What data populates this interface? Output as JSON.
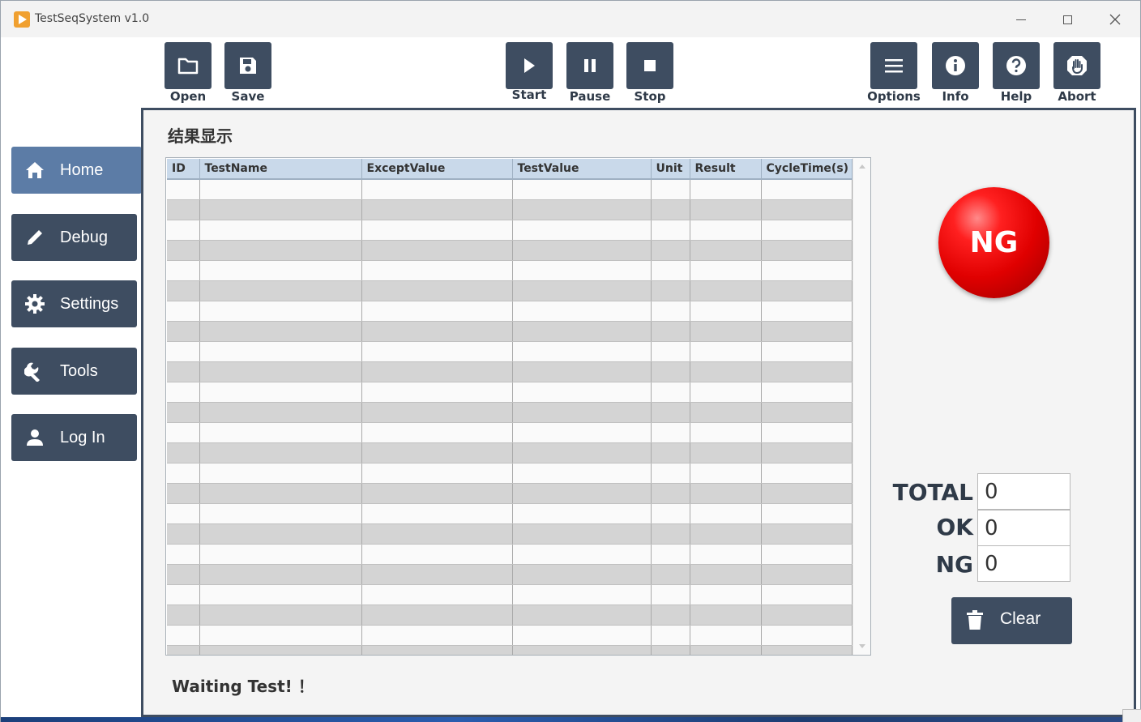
{
  "window": {
    "title": "TestSeqSystem v1.0"
  },
  "toolbar": [
    {
      "key": "open",
      "label": "Open",
      "icon": "folder-icon"
    },
    {
      "key": "save",
      "label": "Save",
      "icon": "floppy-icon"
    },
    {
      "key": "start",
      "label": "Start",
      "icon": "play-icon"
    },
    {
      "key": "pause",
      "label": "Pause",
      "icon": "pause-icon"
    },
    {
      "key": "stop",
      "label": "Stop",
      "icon": "stop-icon"
    },
    {
      "key": "options",
      "label": "Options",
      "icon": "menu-icon"
    },
    {
      "key": "info",
      "label": "Info",
      "icon": "info-icon"
    },
    {
      "key": "help",
      "label": "Help",
      "icon": "question-icon"
    },
    {
      "key": "abort",
      "label": "Abort",
      "icon": "hand-icon"
    }
  ],
  "sidebar": {
    "items": [
      {
        "label": "Home",
        "icon": "home-icon",
        "active": true
      },
      {
        "label": "Debug",
        "icon": "pencil-icon",
        "active": false
      },
      {
        "label": "Settings",
        "icon": "gear-icon",
        "active": false
      },
      {
        "label": "Tools",
        "icon": "wrench-icon",
        "active": false
      },
      {
        "label": "Log In",
        "icon": "user-icon",
        "active": false
      }
    ]
  },
  "main": {
    "title": "结果显示",
    "table": {
      "columns": [
        "ID",
        "TestName",
        "ExceptValue",
        "TestValue",
        "Unit",
        "Result",
        "CycleTime(s)"
      ],
      "rows": []
    },
    "status": "Waiting Test! ！",
    "result_lamp": {
      "text": "NG",
      "color": "#e00000"
    },
    "counters": {
      "total_label": "TOTAL",
      "total_value": "0",
      "ok_label": "OK",
      "ok_value": "0",
      "ng_label": "NG",
      "ng_value": "0"
    },
    "clear_label": "Clear"
  },
  "colors": {
    "button": "#3e4d61",
    "active_nav": "#5c7ca6",
    "table_header": "#c9d9ea"
  }
}
